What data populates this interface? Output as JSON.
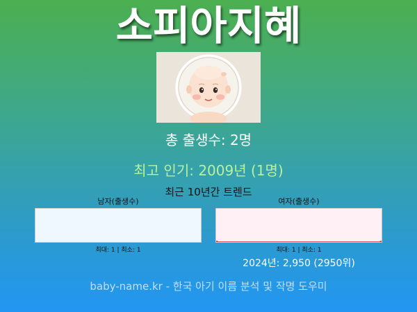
{
  "name_title": "소피아지혜",
  "total_births": "총 출생수: 2명",
  "most_popular": "최고 인기: 2009년 (1명)",
  "trend_title": "최근 10년간 트렌드",
  "male_panel": {
    "label": "남자(출생수)",
    "stats": "최대: 1 | 최소: 1",
    "background": "#f0f8ff"
  },
  "female_panel": {
    "label": "여자(출생수)",
    "stats": "최대: 1 | 최소: 1",
    "rank_text": "2024년: 2,950 (2950위)",
    "background": "#fff0f5",
    "line_color": "#d32f2f"
  },
  "footer": "baby-name.kr - 한국 아기 이름 분석 및 작명 도우미",
  "colors": {
    "gradient_top": "#4caf50",
    "gradient_bottom": "#2196f3",
    "popular_text": "#b9f29a"
  }
}
